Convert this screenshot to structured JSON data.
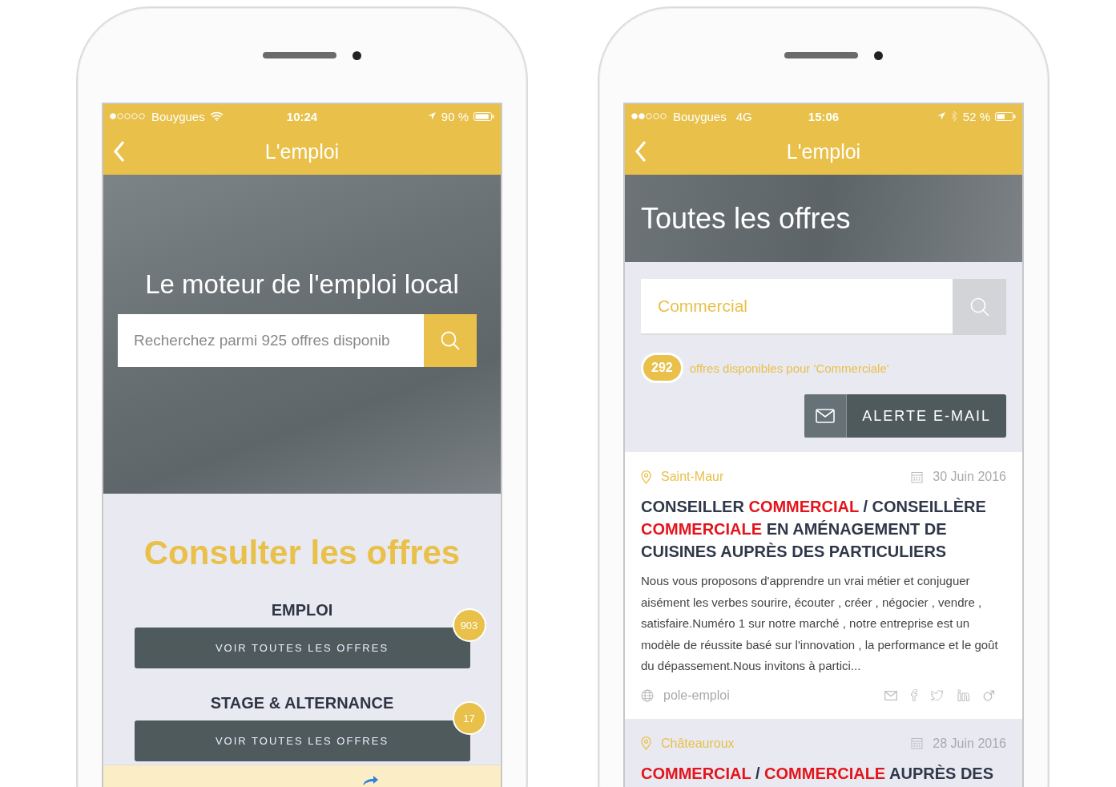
{
  "phones": [
    {
      "kind": "home",
      "status_bar": {
        "carrier": "Bouygues",
        "wifi": true,
        "time": "10:24",
        "battery": "90 %"
      },
      "header": {
        "title": "L'emploi"
      },
      "hero": {
        "headline": "Le moteur de l'emploi local",
        "search": {
          "placeholder": "Recherchez parmi 925 offres disponib"
        }
      },
      "heading": "Consulter les offres",
      "categories": [
        {
          "title": "EMPLOI",
          "button": "VOIR TOUTES LES OFFRES",
          "count": "903"
        },
        {
          "title": "STAGE & ALTERNANCE",
          "button": "VOIR TOUTES LES OFFRES",
          "count": "17"
        }
      ]
    },
    {
      "kind": "results",
      "status_bar": {
        "carrier": "Bouygues",
        "network": "4G",
        "time": "15:06",
        "bluetooth": true,
        "battery": "52 %"
      },
      "header": {
        "title": "L'emploi"
      },
      "hero": {
        "headline": "Toutes les offres"
      },
      "search": {
        "value": "Commercial"
      },
      "result_count": "292",
      "result_text": "offres disponibles pour 'Commerciale'",
      "alert_button": "ALERTE E-MAIL",
      "offers": [
        {
          "location": "Saint-Maur",
          "date": "30 Juin 2016",
          "title": [
            {
              "text": "CONSEILLER ",
              "highlight": false
            },
            {
              "text": "COMMERCIAL",
              "highlight": true
            },
            {
              "text": " / CONSEILLÈRE ",
              "highlight": false
            },
            {
              "text": "COMMERCIALE",
              "highlight": true
            },
            {
              "text": " EN AMÉNAGEMENT DE CUISINES AUPRÈS DES PARTICULIERS",
              "highlight": false
            }
          ],
          "description": "Nous vous proposons d'apprendre un vrai métier et conjuguer aisément les verbes sourire, écouter , créer , négocier , vendre , satisfaire.Numéro 1 sur notre marché , notre entreprise est un modèle de réussite basé sur l'innovation , la performance et le goût du dépassement.Nous invitons à partici...",
          "source": "pole-emploi"
        },
        {
          "location": "Châteauroux",
          "date": "28 Juin 2016",
          "title": [
            {
              "text": "COMMERCIAL",
              "highlight": true
            },
            {
              "text": " / ",
              "highlight": false
            },
            {
              "text": "COMMERCIALE",
              "highlight": true
            },
            {
              "text": " AUPRÈS DES",
              "highlight": false
            }
          ]
        }
      ]
    }
  ]
}
